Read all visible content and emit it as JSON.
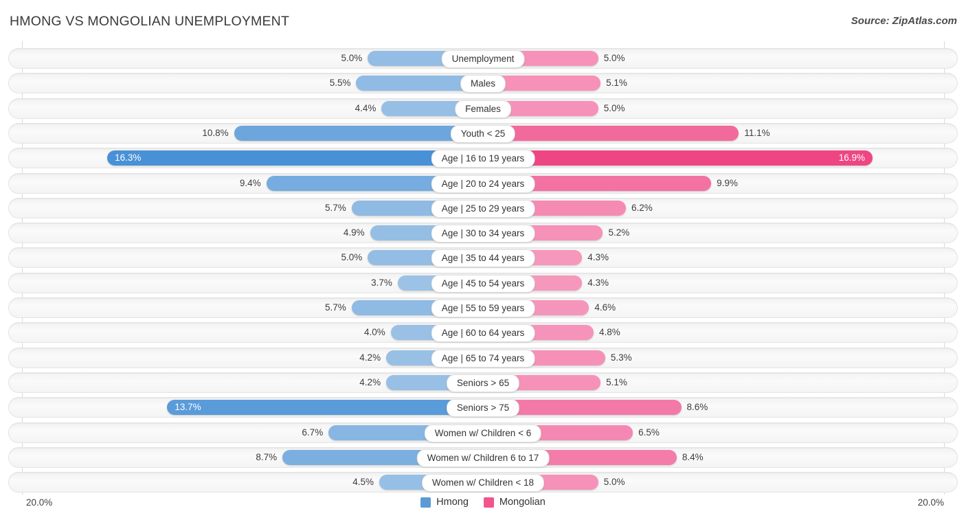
{
  "header": {
    "title": "HMONG VS MONGOLIAN UNEMPLOYMENT",
    "source": "Source: ZipAtlas.com"
  },
  "axis": {
    "left_extreme": "20.0%",
    "right_extreme": "20.0%"
  },
  "legend": {
    "items": [
      {
        "label": "Hmong",
        "color": "#5b9bd5"
      },
      {
        "label": "Mongolian",
        "color": "#f2558c"
      }
    ]
  },
  "chart_data": {
    "type": "bar",
    "orientation": "horizontal-diverging",
    "title": "HMONG VS MONGOLIAN UNEMPLOYMENT",
    "xlabel": "",
    "ylabel": "",
    "axis_max": 20.0,
    "unit": "%",
    "grid": true,
    "legend_position": "bottom-center",
    "categories": [
      "Unemployment",
      "Males",
      "Females",
      "Youth < 25",
      "Age | 16 to 19 years",
      "Age | 20 to 24 years",
      "Age | 25 to 29 years",
      "Age | 30 to 34 years",
      "Age | 35 to 44 years",
      "Age | 45 to 54 years",
      "Age | 55 to 59 years",
      "Age | 60 to 64 years",
      "Age | 65 to 74 years",
      "Seniors > 65",
      "Seniors > 75",
      "Women w/ Children < 6",
      "Women w/ Children 6 to 17",
      "Women w/ Children < 18"
    ],
    "series": [
      {
        "name": "Hmong",
        "side": "left",
        "color": "#5b9bd5",
        "values": [
          5.0,
          5.5,
          4.4,
          10.8,
          16.3,
          9.4,
          5.7,
          4.9,
          5.0,
          3.7,
          5.7,
          4.0,
          4.2,
          4.2,
          13.7,
          6.7,
          8.7,
          4.5
        ],
        "labels": [
          "5.0%",
          "5.5%",
          "4.4%",
          "10.8%",
          "16.3%",
          "9.4%",
          "5.7%",
          "4.9%",
          "5.0%",
          "3.7%",
          "5.7%",
          "4.0%",
          "4.2%",
          "4.2%",
          "13.7%",
          "6.7%",
          "8.7%",
          "4.5%"
        ]
      },
      {
        "name": "Mongolian",
        "side": "right",
        "color": "#f2558c",
        "values": [
          5.0,
          5.1,
          5.0,
          11.1,
          16.9,
          9.9,
          6.2,
          5.2,
          4.3,
          4.3,
          4.6,
          4.8,
          5.3,
          5.1,
          8.6,
          6.5,
          8.4,
          5.0
        ],
        "labels": [
          "5.0%",
          "5.1%",
          "5.0%",
          "11.1%",
          "16.9%",
          "9.9%",
          "6.2%",
          "5.2%",
          "4.3%",
          "4.3%",
          "4.6%",
          "4.8%",
          "5.3%",
          "5.1%",
          "8.6%",
          "6.5%",
          "8.4%",
          "5.0%"
        ]
      }
    ]
  }
}
